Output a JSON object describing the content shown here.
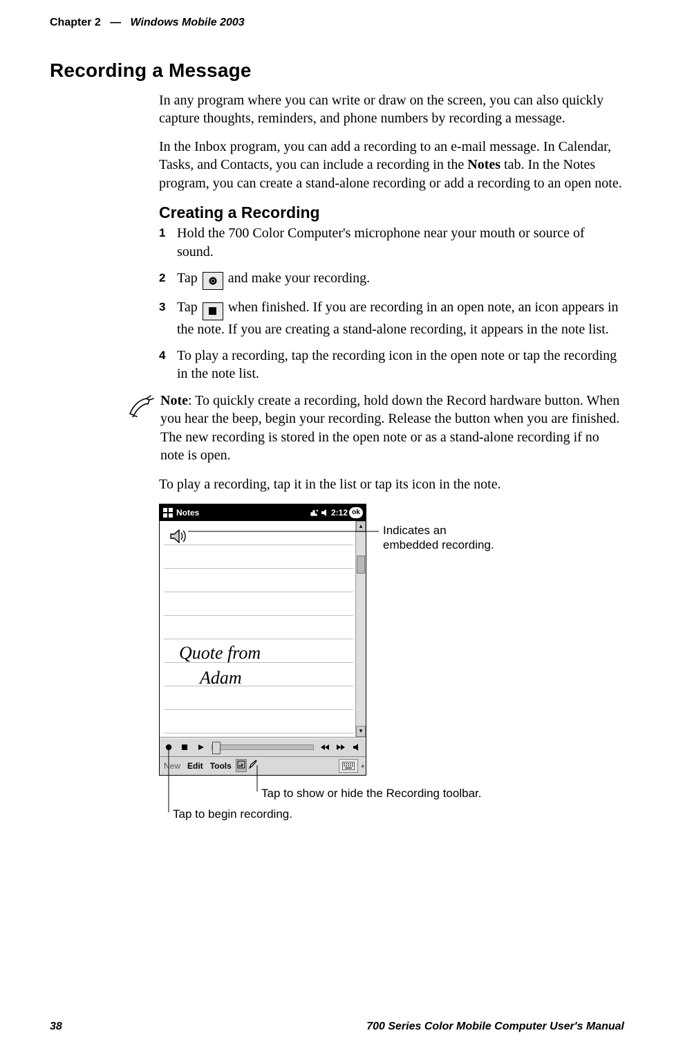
{
  "header": {
    "chapter_label": "Chapter 2",
    "dash": "—",
    "chapter_title": "Windows Mobile 2003"
  },
  "footer": {
    "page_number": "38",
    "manual_title": "700 Series Color Mobile Computer User's Manual"
  },
  "section": {
    "title": "Recording a Message",
    "intro_p1": "In any program where you can write or draw on the screen, you can also quickly capture thoughts, reminders, and phone numbers by recording a message.",
    "intro_p2a": "In the Inbox program, you can add a recording to an e-mail message. In Calendar, Tasks, and Contacts, you can include a recording in the ",
    "intro_p2_bold": "Notes",
    "intro_p2b": " tab. In the Notes program, you can create a stand-alone recording or add a recording to an open note."
  },
  "subsection": {
    "title": "Creating a Recording",
    "step1": "Hold the 700 Color Computer's microphone near your mouth or source of sound.",
    "step2_a": "Tap ",
    "step2_b": " and make your recording.",
    "step3_a": "Tap ",
    "step3_b": " when finished. If you are recording in an open note, an icon appears in the note. If you are creating a stand-alone recording, it appears in the note list.",
    "step4": "To play a recording, tap the recording icon in the open note or tap the recording in the note list."
  },
  "note": {
    "label": "Note",
    "text": ": To quickly create a recording, hold down the Record hardware button. When you hear the beep, begin your recording. Release the button when you are finished. The new recording is stored in the open note or as a stand-alone recording if no note is open."
  },
  "play_line": "To play a recording, tap it in the list or tap its icon in the note.",
  "screenshot": {
    "app_title": "Notes",
    "clock": "2:12",
    "ok_label": "ok",
    "hw_line1": "Quote from",
    "hw_line2": "Adam",
    "menu_new": "New",
    "menu_edit": "Edit",
    "menu_tools": "Tools"
  },
  "callouts": {
    "embedded": "Indicates an embedded recording.",
    "toolbar": "Tap to show or hide the Recording toolbar.",
    "begin": "Tap to begin recording."
  },
  "icons": {
    "record_button": "record-icon",
    "stop_button": "stop-icon",
    "note_hand": "note-hand-icon"
  }
}
